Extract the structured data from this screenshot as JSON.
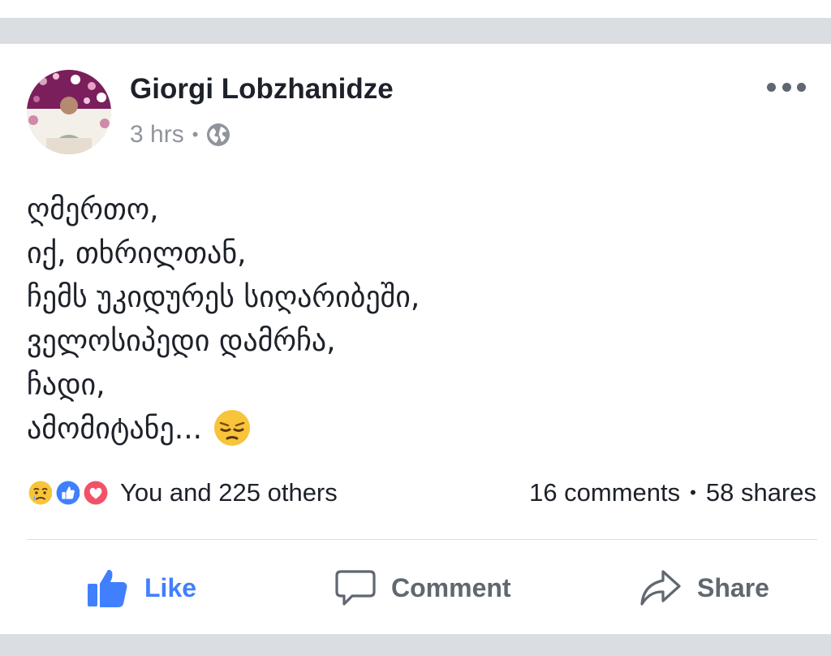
{
  "post": {
    "author_name": "Giorgi Lobzhanidze",
    "time": "3 hrs",
    "privacy_icon": "globe-icon",
    "more_icon": "more-options-icon",
    "lines": [
      "ღმერთო,",
      "იქ, თხრილთან,",
      "ჩემს უკიდურეს სიღარიბეში,",
      "ველოსიპედი დამრჩა,",
      "ჩადი,",
      "ამომიტანე..."
    ],
    "trailing_emoji": "pensive-face-emoji"
  },
  "reactions": {
    "icons": [
      "sad-reaction-icon",
      "like-reaction-icon",
      "love-reaction-icon"
    ],
    "summary": "You and 225 others",
    "comments": "16 comments",
    "shares": "58 shares"
  },
  "actions": {
    "like": "Like",
    "comment": "Comment",
    "share": "Share"
  },
  "colors": {
    "like_active": "#4080ff",
    "love": "#f25268",
    "muted": "#606770",
    "timestamp": "#90949c",
    "background_strip": "#dadde1"
  }
}
